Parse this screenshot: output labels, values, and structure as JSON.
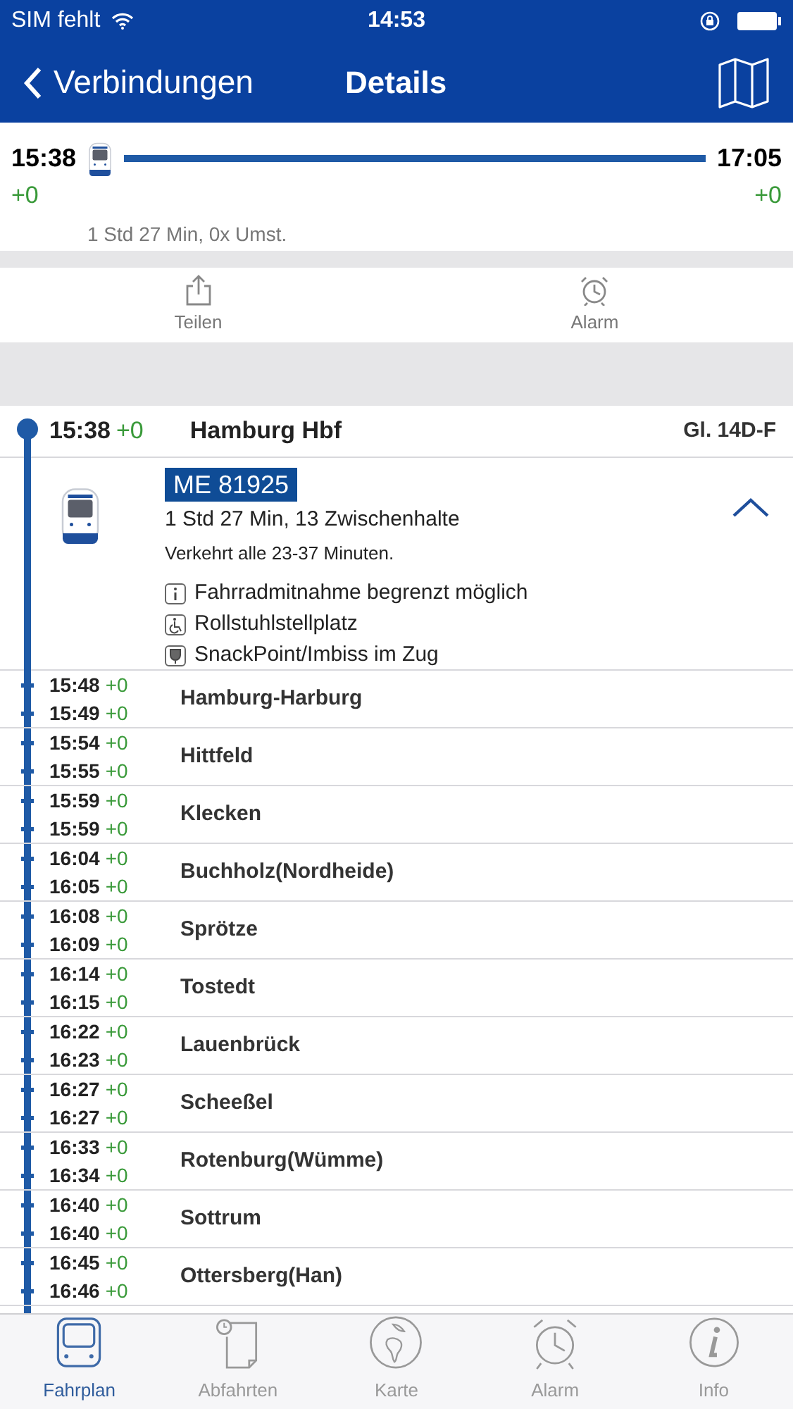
{
  "status_bar": {
    "carrier": "SIM fehlt",
    "time": "14:53"
  },
  "nav": {
    "back": "Verbindungen",
    "title": "Details"
  },
  "summary": {
    "dep_time": "15:38",
    "dep_delay": "+0",
    "arr_time": "17:05",
    "arr_delay": "+0",
    "info": "1 Std 27 Min, 0x Umst."
  },
  "actions": [
    {
      "kind": "share",
      "label": "Teilen"
    },
    {
      "kind": "alarm",
      "label": "Alarm"
    }
  ],
  "departure": {
    "time": "15:38",
    "delay": "+0",
    "station": "Hamburg Hbf",
    "platform": "Gl. 14D-F"
  },
  "train": {
    "name": "ME 81925",
    "duration": "1 Std 27 Min, 13 Zwischenhalte",
    "frequency": "Verkehrt alle 23-37 Minuten.",
    "expanded": true,
    "notes": [
      {
        "kind": "info",
        "text": "Fahrradmitnahme begrenzt möglich"
      },
      {
        "kind": "wheelchair",
        "text": "Rollstuhlstellplatz"
      },
      {
        "kind": "snack",
        "text": "SnackPoint/Imbiss im Zug"
      }
    ]
  },
  "stops": [
    {
      "arr": "15:48",
      "arr_delay": "+0",
      "dep": "15:49",
      "dep_delay": "+0",
      "station": "Hamburg-Harburg"
    },
    {
      "arr": "15:54",
      "arr_delay": "+0",
      "dep": "15:55",
      "dep_delay": "+0",
      "station": "Hittfeld"
    },
    {
      "arr": "15:59",
      "arr_delay": "+0",
      "dep": "15:59",
      "dep_delay": "+0",
      "station": "Klecken"
    },
    {
      "arr": "16:04",
      "arr_delay": "+0",
      "dep": "16:05",
      "dep_delay": "+0",
      "station": "Buchholz(Nordheide)"
    },
    {
      "arr": "16:08",
      "arr_delay": "+0",
      "dep": "16:09",
      "dep_delay": "+0",
      "station": "Sprötze"
    },
    {
      "arr": "16:14",
      "arr_delay": "+0",
      "dep": "16:15",
      "dep_delay": "+0",
      "station": "Tostedt"
    },
    {
      "arr": "16:22",
      "arr_delay": "+0",
      "dep": "16:23",
      "dep_delay": "+0",
      "station": "Lauenbrück"
    },
    {
      "arr": "16:27",
      "arr_delay": "+0",
      "dep": "16:27",
      "dep_delay": "+0",
      "station": "Scheeßel"
    },
    {
      "arr": "16:33",
      "arr_delay": "+0",
      "dep": "16:34",
      "dep_delay": "+0",
      "station": "Rotenburg(Wümme)"
    },
    {
      "arr": "16:40",
      "arr_delay": "+0",
      "dep": "16:40",
      "dep_delay": "+0",
      "station": "Sottrum"
    },
    {
      "arr": "16:45",
      "arr_delay": "+0",
      "dep": "16:46",
      "dep_delay": "+0",
      "station": "Ottersberg(Han)"
    }
  ],
  "tab_bar": [
    {
      "kind": "timetable",
      "label": "Fahrplan",
      "selected": true
    },
    {
      "kind": "departures",
      "label": "Abfahrten",
      "selected": false
    },
    {
      "kind": "map",
      "label": "Karte",
      "selected": false
    },
    {
      "kind": "alarm",
      "label": "Alarm",
      "selected": false
    },
    {
      "kind": "info",
      "label": "Info",
      "selected": false
    }
  ]
}
